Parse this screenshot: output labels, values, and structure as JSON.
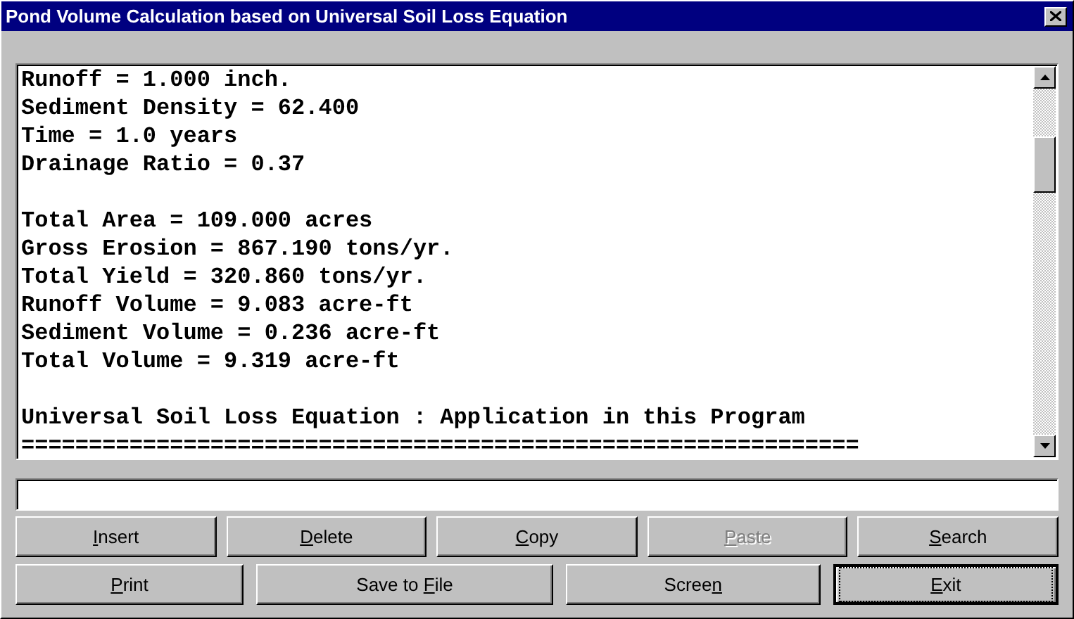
{
  "window": {
    "title": "Pond Volume Calculation based on Universal Soil Loss Equation"
  },
  "output": {
    "paragraphs": [
      [
        "Runoff = 1.000 inch.",
        "Sediment Density = 62.400",
        "Time = 1.0 years",
        "Drainage Ratio = 0.37"
      ],
      [
        "Total Area = 109.000 acres",
        "Gross Erosion = 867.190 tons/yr.",
        "Total Yield = 320.860 tons/yr.",
        "Runoff Volume = 9.083 acre-ft",
        "Sediment Volume = 0.236 acre-ft",
        "Total Volume = 9.319 acre-ft"
      ],
      [
        "Universal Soil Loss Equation : Application in this Program",
        "=============================================================="
      ]
    ]
  },
  "button_rows": [
    [
      {
        "label": {
          "key": "I",
          "after": "nsert"
        },
        "disabled": false,
        "default": false
      },
      {
        "label": {
          "key": "D",
          "after": "elete"
        },
        "disabled": false,
        "default": false
      },
      {
        "label": {
          "key": "C",
          "after": "opy"
        },
        "disabled": false,
        "default": false
      },
      {
        "label": {
          "key": "P",
          "after": "aste"
        },
        "disabled": true,
        "default": false
      },
      {
        "label": {
          "key": "S",
          "after": "earch"
        },
        "disabled": false,
        "default": false
      }
    ],
    [
      {
        "label": {
          "key": "P",
          "after": "rint"
        },
        "disabled": false,
        "default": false
      },
      {
        "label": {
          "before": "Save to ",
          "key": "F",
          "after": "ile"
        },
        "disabled": false,
        "default": false
      },
      {
        "label": {
          "before": "Scree",
          "key": "n"
        },
        "disabled": false,
        "default": false
      },
      {
        "label": {
          "key": "E",
          "after": "xit"
        },
        "disabled": false,
        "default": true
      }
    ]
  ]
}
